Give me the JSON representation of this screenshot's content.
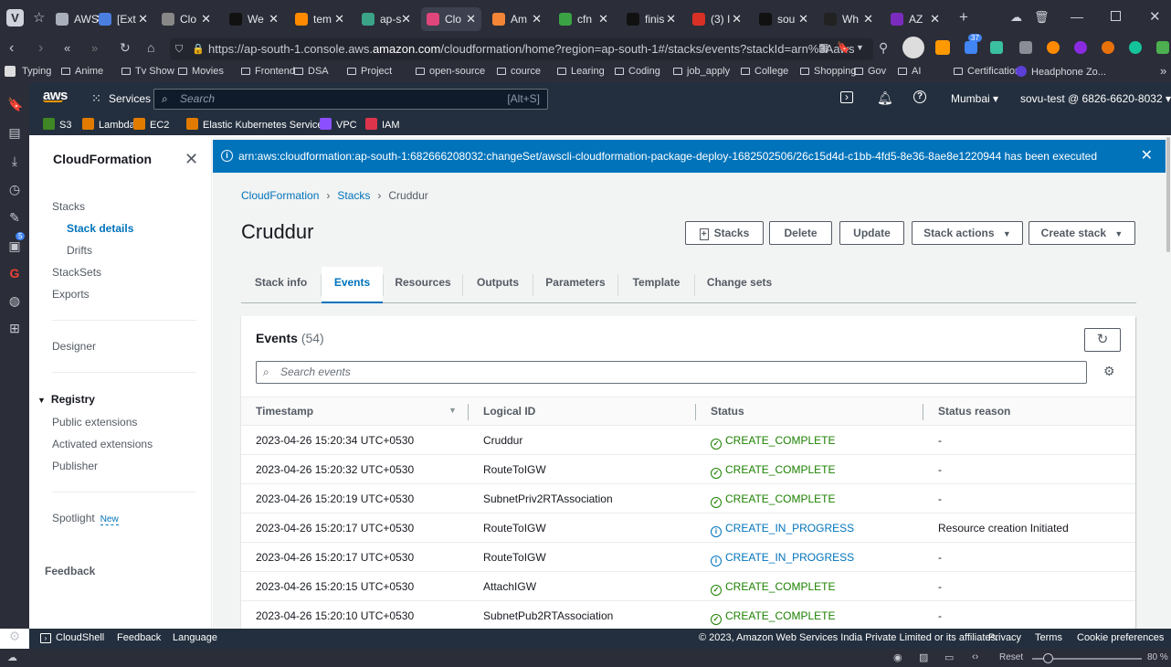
{
  "browser": {
    "tabs": [
      {
        "label": "AWS",
        "icon_color": "#aab0bb"
      },
      {
        "label": "[Ext",
        "icon_color": "#4a7fe0"
      },
      {
        "label": "Clo",
        "icon_color": "#888"
      },
      {
        "label": "We",
        "icon_color": "#111"
      },
      {
        "label": "tem",
        "icon_color": "#ff8a00"
      },
      {
        "label": "ap-s",
        "icon_color": "#3aa388"
      },
      {
        "label": "Clo",
        "icon_color": "#e0457b"
      },
      {
        "label": "Am",
        "icon_color": "#f58536"
      },
      {
        "label": "cfn",
        "icon_color": "#3aa343"
      },
      {
        "label": "finis",
        "icon_color": "#111"
      },
      {
        "label": "(3) I",
        "icon_color": "#d93025"
      },
      {
        "label": "sou",
        "icon_color": "#111"
      },
      {
        "label": "Wh",
        "icon_color": "#222"
      },
      {
        "label": "AZ",
        "icon_color": "#7b2cbf"
      }
    ],
    "url_prefix": "https://ap-south-1.console.aws.",
    "url_domain": "amazon.com",
    "url_suffix": "/cloudformation/home?region=ap-south-1#/stacks/events?stackId=arn%3Aaws",
    "extension_badge": "37",
    "bookmarks": [
      "Typing",
      "Anime",
      "Tv Show",
      "Movies",
      "Frontend",
      "DSA",
      "Project",
      "open-source",
      "cource",
      "Learing",
      "Coding",
      "job_apply",
      "College",
      "Shopping",
      "Gov",
      "AI",
      "Certifications",
      "Headphone Zo..."
    ],
    "rail_badge": "5",
    "statusbar": {
      "reset": "Reset",
      "zoom": "80 %"
    }
  },
  "aws_nav": {
    "logo": "aws",
    "services": "Services",
    "search_placeholder": "Search",
    "search_shortcut": "[Alt+S]",
    "region": "Mumbai",
    "account": "sovu-test @ 6826-6620-8032"
  },
  "favorites": [
    {
      "label": "S3",
      "color": "#3f8624"
    },
    {
      "label": "Lambda",
      "color": "#e07b00"
    },
    {
      "label": "EC2",
      "color": "#e07b00"
    },
    {
      "label": "Elastic Kubernetes Service",
      "color": "#e07b00"
    },
    {
      "label": "VPC",
      "color": "#8c4fff"
    },
    {
      "label": "IAM",
      "color": "#dd344c"
    }
  ],
  "sidenav": {
    "title": "CloudFormation",
    "stacks": "Stacks",
    "stack_details": "Stack details",
    "drifts": "Drifts",
    "stacksets": "StackSets",
    "exports": "Exports",
    "designer": "Designer",
    "registry": "Registry",
    "public_extensions": "Public extensions",
    "activated_extensions": "Activated extensions",
    "publisher": "Publisher",
    "spotlight": "Spotlight",
    "new_badge": "New",
    "feedback": "Feedback"
  },
  "flash": {
    "message": "arn:aws:cloudformation:ap-south-1:682666208032:changeSet/awscli-cloudformation-package-deploy-1682502506/26c15d4d-c1bb-4fd5-8e36-8ae8e1220944 has been executed"
  },
  "breadcrumb": [
    "CloudFormation",
    "Stacks",
    "Cruddur"
  ],
  "stack_name": "Cruddur",
  "actions": {
    "stacks": "Stacks",
    "delete": "Delete",
    "update": "Update",
    "stack_actions": "Stack actions",
    "create_stack": "Create stack"
  },
  "tabs": [
    "Stack info",
    "Events",
    "Resources",
    "Outputs",
    "Parameters",
    "Template",
    "Change sets"
  ],
  "events": {
    "title": "Events",
    "count": "(54)",
    "search_placeholder": "Search events",
    "columns": [
      "Timestamp",
      "Logical ID",
      "Status",
      "Status reason"
    ],
    "rows": [
      {
        "timestamp": "2023-04-26 15:20:34 UTC+0530",
        "logical_id": "Cruddur",
        "status": "CREATE_COMPLETE",
        "reason": "-"
      },
      {
        "timestamp": "2023-04-26 15:20:32 UTC+0530",
        "logical_id": "RouteToIGW",
        "status": "CREATE_COMPLETE",
        "reason": "-"
      },
      {
        "timestamp": "2023-04-26 15:20:19 UTC+0530",
        "logical_id": "SubnetPriv2RTAssociation",
        "status": "CREATE_COMPLETE",
        "reason": "-"
      },
      {
        "timestamp": "2023-04-26 15:20:17 UTC+0530",
        "logical_id": "RouteToIGW",
        "status": "CREATE_IN_PROGRESS",
        "reason": "Resource creation Initiated"
      },
      {
        "timestamp": "2023-04-26 15:20:17 UTC+0530",
        "logical_id": "RouteToIGW",
        "status": "CREATE_IN_PROGRESS",
        "reason": "-"
      },
      {
        "timestamp": "2023-04-26 15:20:15 UTC+0530",
        "logical_id": "AttachIGW",
        "status": "CREATE_COMPLETE",
        "reason": "-"
      },
      {
        "timestamp": "2023-04-26 15:20:10 UTC+0530",
        "logical_id": "SubnetPub2RTAssociation",
        "status": "CREATE_COMPLETE",
        "reason": "-"
      }
    ],
    "status_colors": {
      "CREATE_COMPLETE": "#1d8102",
      "CREATE_IN_PROGRESS": "#0073bb"
    }
  },
  "footer": {
    "cloudshell": "CloudShell",
    "feedback": "Feedback",
    "language": "Language",
    "copyright": "© 2023, Amazon Web Services India Private Limited or its affiliates.",
    "privacy": "Privacy",
    "terms": "Terms",
    "cookies": "Cookie preferences"
  }
}
